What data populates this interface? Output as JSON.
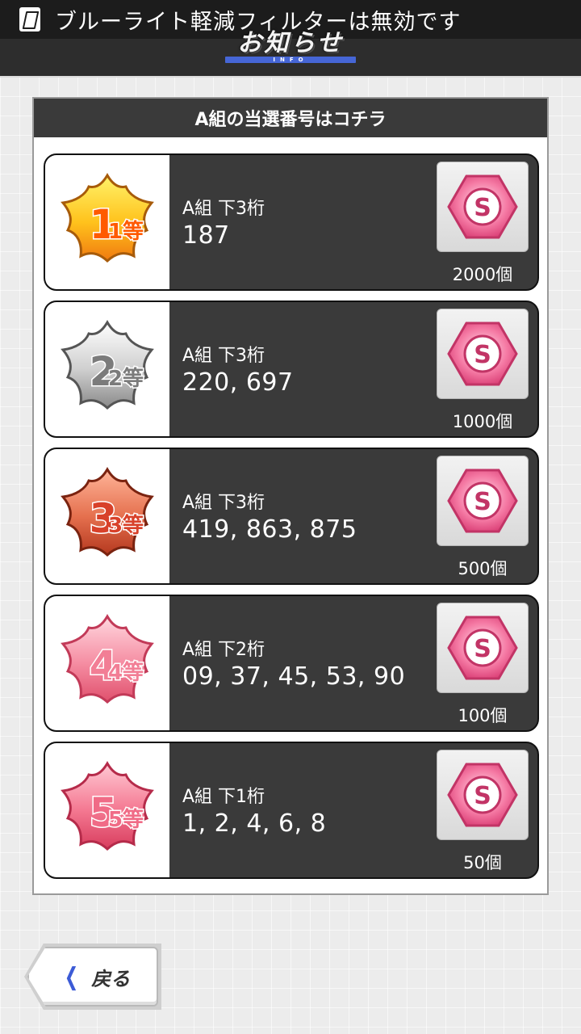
{
  "status_bar": {
    "icon": "bluelight-filter-icon",
    "text": "ブルーライト軽減フィルターは無効です"
  },
  "header": {
    "title": "お知らせ",
    "subtitle": "INFO",
    "accent": "#4666d6"
  },
  "panel": {
    "title": "A組の当選番号はコチラ",
    "prizes": [
      {
        "rank_icon": "first-prize-badge-icon",
        "rank_text": "1等",
        "badge_color": "#f4a21a",
        "digits_label": "A組 下3桁",
        "numbers": "187",
        "reward_icon": "s-gem-icon",
        "quantity": "2000個"
      },
      {
        "rank_icon": "second-prize-badge-icon",
        "rank_text": "2等",
        "badge_color": "#9c9c9c",
        "digits_label": "A組 下3桁",
        "numbers": "220, 697",
        "reward_icon": "s-gem-icon",
        "quantity": "1000個"
      },
      {
        "rank_icon": "third-prize-badge-icon",
        "rank_text": "3等",
        "badge_color": "#d8553a",
        "digits_label": "A組 下3桁",
        "numbers": "419, 863, 875",
        "reward_icon": "s-gem-icon",
        "quantity": "500個"
      },
      {
        "rank_icon": "fourth-prize-badge-icon",
        "rank_text": "4等",
        "badge_color": "#f27e95",
        "digits_label": "A組 下2桁",
        "numbers": "09, 37, 45, 53, 90",
        "reward_icon": "s-gem-icon",
        "quantity": "100個"
      },
      {
        "rank_icon": "fifth-prize-badge-icon",
        "rank_text": "5等",
        "badge_color": "#f06b86",
        "digits_label": "A組 下1桁",
        "numbers": "1, 2, 4, 6, 8",
        "reward_icon": "s-gem-icon",
        "quantity": "50個"
      }
    ]
  },
  "back_button": {
    "label": "戻る",
    "icon": "chevron-left-icon"
  }
}
